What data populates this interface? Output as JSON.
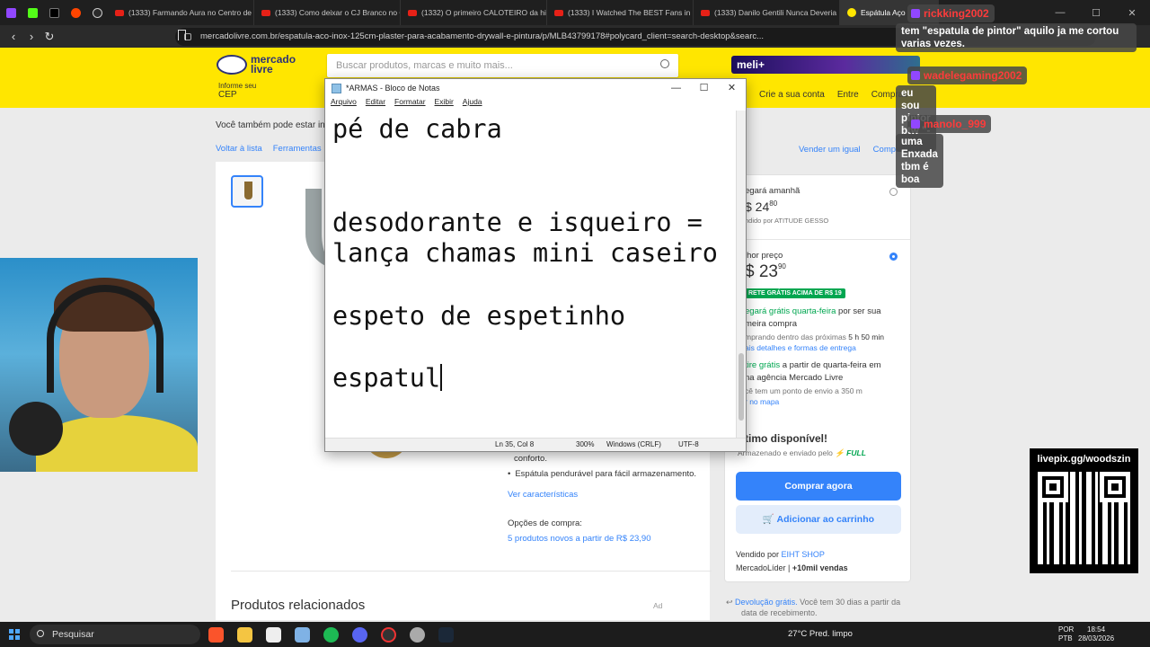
{
  "browser": {
    "tabs": [
      {
        "label": "(1333) Farmando Aura no Centro de"
      },
      {
        "label": "(1333) Como deixar o CJ Branco no G"
      },
      {
        "label": "(1332) O primeiro CALOTEIRO da hist"
      },
      {
        "label": "(1333) I Watched The BEST Fans in Bl"
      },
      {
        "label": "(1333) Danilo Gentili Nunca Deveria"
      },
      {
        "label": "Espátula Aço"
      }
    ],
    "url": "mercadolivre.com.br/espatula-aco-inox-125cm-plaster-para-acabamento-drywall-e-pintura/p/MLB43799178#polycard_client=search-desktop&searc..."
  },
  "ml": {
    "logo_line1": "mercado",
    "logo_line2": "livre",
    "search_placeholder": "Buscar produtos, marcas e muito mais...",
    "meli_label": "meli+",
    "cep_label": "Informe seu",
    "cep_value": "CEP",
    "nav": [
      "Crie a sua conta",
      "Entre",
      "Compras"
    ],
    "also_search": "Você também pode estar inte",
    "breadcrumbs": [
      "Voltar à lista",
      "Ferramentas"
    ],
    "sell_links": [
      "Vender um igual",
      "Compartilhar"
    ]
  },
  "product": {
    "features": {
      "frag": "conforto.",
      "bullet": "Espátula pendurável para fácil armazenamento.",
      "see_features": "Ver características",
      "options_label": "Opções de compra:",
      "options_link": "5 produtos novos a partir de R$ 23,90"
    },
    "related": "Produtos relacionados",
    "ad": "Ad"
  },
  "buybox": {
    "opt1_title": "egará amanhã",
    "opt1_price": "$ 24",
    "opt1_cents": "80",
    "opt1_seller": "ndido por ATITUDE GESSO",
    "opt2_title": "lhor preço",
    "opt2_price": "$ 23",
    "opt2_cents": "90",
    "free_badge": "RETE GRÁTIS ACIMA DE R$ 19",
    "ship_green": "egará grátis quarta-feira",
    "ship_rest": " por ser sua",
    "ship_line2": "meira compra",
    "buy_within_a": "mprando dentro das próximas ",
    "buy_within_b": "5 h 50 min",
    "ship_details": "ais detalhes e formas de entrega",
    "pickup_green": "tire grátis",
    "pickup_rest": " a partir de quarta-feira em",
    "pickup_line2": "na agência Mercado Livre",
    "pickup_line3": "cê tem um ponto de envio a 350 m",
    "map_link": "r no mapa",
    "stock": "timo disponível!",
    "stored_by": "Armazenado e enviado pelo",
    "full_badge": "⚡ FULL",
    "buy_now": "Comprar agora",
    "add_cart": "Adicionar ao carrinho",
    "sold_by_label": "Vendido por ",
    "sold_by": "EIHT SHOP",
    "leader": "MercadoLíder",
    "sales": "+10mil vendas",
    "returns_link": "Devolução grátis.",
    "returns_text": " Você tem 30 dias a partir da",
    "returns_line2": "data de recebimento."
  },
  "notepad": {
    "title": "*ARMAS - Bloco de Notas",
    "menu": [
      "Arquivo",
      "Editar",
      "Formatar",
      "Exibir",
      "Ajuda"
    ],
    "content": "pé de cabra\n\n\ndesodorante e isqueiro =\nlança chamas mini caseiro\n\nespeto de espetinho\n\nespatul",
    "status": {
      "position": "Ln 35, Col 8",
      "zoom": "300%",
      "eol": "Windows (CRLF)",
      "encoding": "UTF-8"
    }
  },
  "chat": [
    {
      "user": "rickking2002",
      "text": "tem \"espatula de pintor\" aquilo ja me cortou\nvarias vezes."
    },
    {
      "user": "wadelegaming2002",
      "text": "eu sou pintor btw \"-\""
    },
    {
      "user": "manolo_999",
      "text": "uma Enxada tbm é boa"
    }
  ],
  "livepix": {
    "label": "livepix.gg/woodszin"
  },
  "taskbar": {
    "search": "Pesquisar",
    "weather": "27°C  Pred. limpo",
    "lang1": "POR",
    "lang2": "PTB",
    "time": "18:54",
    "date": "28/03/2026"
  },
  "colors": {
    "ml_yellow": "#ffe600",
    "ml_blue": "#3483fa",
    "ml_green": "#00a650",
    "chat_user": "#ff3b3b"
  }
}
